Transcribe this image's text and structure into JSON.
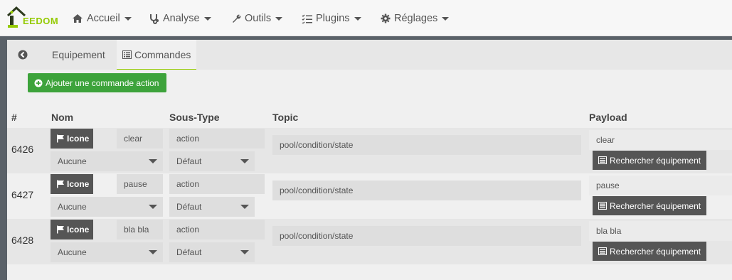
{
  "brand": {
    "logo_text": "EEDOM"
  },
  "nav": [
    {
      "label": "Accueil",
      "icon": "home-icon"
    },
    {
      "label": "Analyse",
      "icon": "stethoscope-icon"
    },
    {
      "label": "Outils",
      "icon": "wrench-icon"
    },
    {
      "label": "Plugins",
      "icon": "list-check-icon"
    },
    {
      "label": "Réglages",
      "icon": "cog-icon"
    }
  ],
  "tabs": {
    "equipement": "Equipement",
    "commandes": "Commandes"
  },
  "toolbar": {
    "add_action_label": "Ajouter une commande action"
  },
  "table": {
    "headers": {
      "id": "#",
      "nom": "Nom",
      "soustype": "Sous-Type",
      "topic": "Topic",
      "payload": "Payload"
    },
    "rows": [
      {
        "id": "6426",
        "icone_label": "Icone",
        "name": "clear",
        "generic": "Aucune",
        "subtype": "action",
        "subtype_option": "Défaut",
        "topic": "pool/condition/state",
        "payload": "clear",
        "search_label": "Rechercher équipement"
      },
      {
        "id": "6427",
        "icone_label": "Icone",
        "name": "pause",
        "generic": "Aucune",
        "subtype": "action",
        "subtype_option": "Défaut",
        "topic": "pool/condition/state",
        "payload": "pause",
        "search_label": "Rechercher équipement"
      },
      {
        "id": "6428",
        "icone_label": "Icone",
        "name": "bla bla",
        "generic": "Aucune",
        "subtype": "action",
        "subtype_option": "Défaut",
        "topic": "pool/condition/state",
        "payload": "bla bla",
        "search_label": "Rechercher équipement"
      }
    ]
  },
  "colors": {
    "accent": "#94ca02",
    "add_button": "#3da33b",
    "dark_button": "#555555"
  }
}
